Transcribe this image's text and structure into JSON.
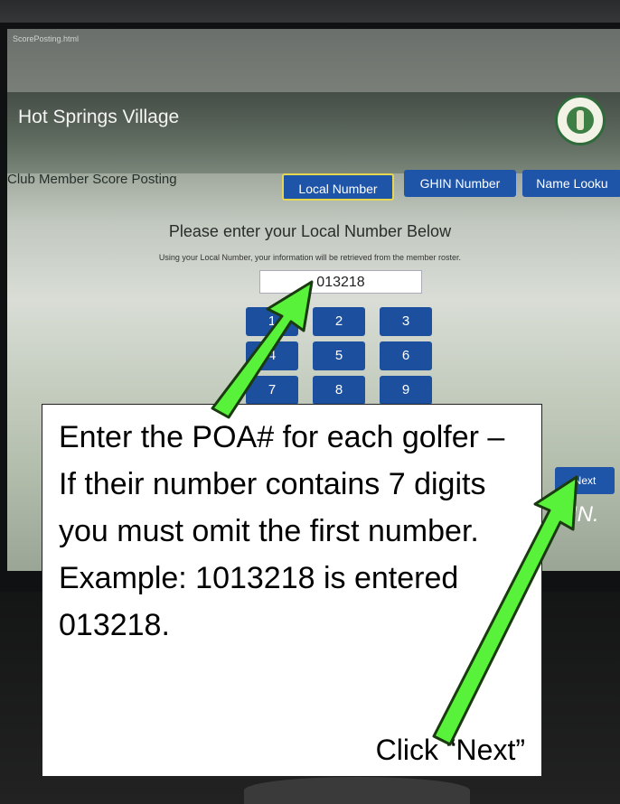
{
  "app": {
    "url": "ScorePosting.html",
    "title": "Hot Springs Village",
    "section_label": "Club Member Score Posting"
  },
  "tabs": [
    {
      "label": "Local Number",
      "active": true
    },
    {
      "label": "GHIN Number",
      "active": false
    },
    {
      "label": "Name Looku",
      "active": false
    }
  ],
  "entry": {
    "heading": "Please enter your Local Number Below",
    "subtext": "Using your Local Number, your information will be retrieved from the member roster.",
    "value": "013218"
  },
  "keypad": {
    "keys": [
      "1",
      "2",
      "3",
      "4",
      "5",
      "6",
      "7",
      "8",
      "9"
    ]
  },
  "actions": {
    "next_label": "Next",
    "ghin_logo_text": "IN."
  },
  "callout": {
    "instruction": "Enter the POA# for each golfer – If their number contains 7 digits you must omit the first number. Example: 1013218 is entered 013218.",
    "next_hint": "Click “Next”"
  },
  "colors": {
    "button_blue": "#1f55a8",
    "active_border": "#e7d64f",
    "arrow_green": "#59f23a"
  }
}
